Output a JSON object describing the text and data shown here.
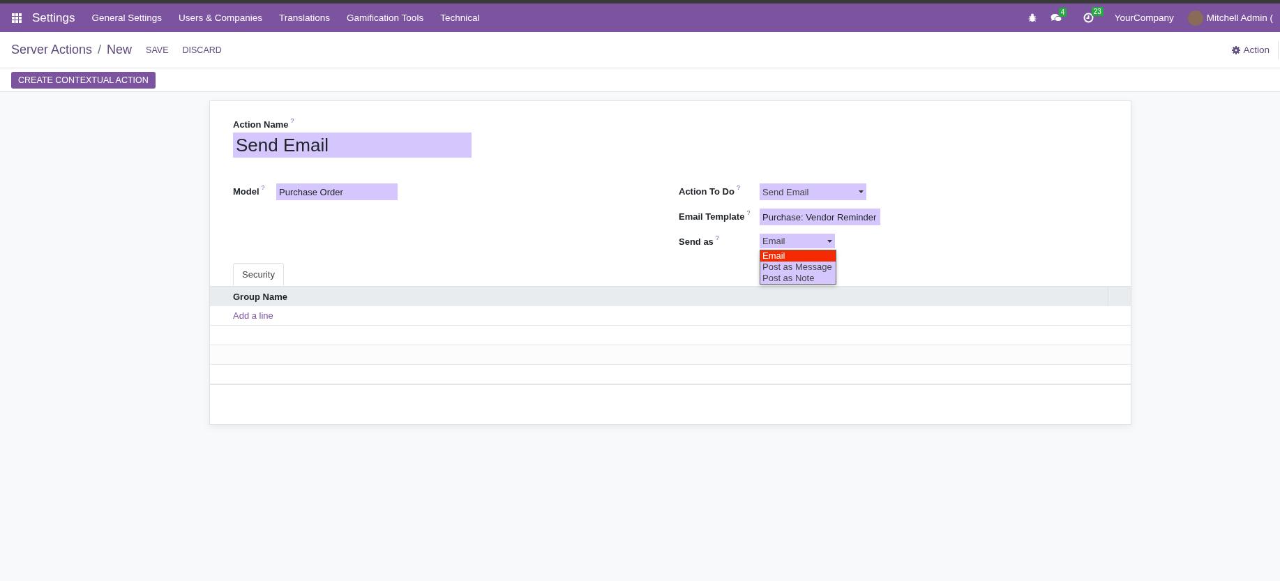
{
  "navbar": {
    "app_name": "Settings",
    "menu": [
      "General Settings",
      "Users & Companies",
      "Translations",
      "Gamification Tools",
      "Technical"
    ],
    "messages_count": "4",
    "activities_count": "23",
    "company": "YourCompany",
    "user": "Mitchell Admin ("
  },
  "breadcrumb": {
    "parent": "Server Actions",
    "separator": "/",
    "current": "New"
  },
  "header_buttons": [
    "SAVE",
    "DISCARD"
  ],
  "action_menu": "Action",
  "statusbar_button": "CREATE CONTEXTUAL ACTION",
  "form": {
    "action_name_label": "Action Name",
    "action_name_help": "?",
    "action_name": "Send Email",
    "model": {
      "label": "Model",
      "help": "?",
      "value": "Purchase Order"
    },
    "right_fields": [
      {
        "kind": "select",
        "label": "Action To Do",
        "help": "?",
        "value": "Send Email"
      },
      {
        "kind": "input",
        "label": "Email Template",
        "help": "?",
        "value": "Purchase: Vendor Reminder"
      },
      {
        "kind": "select",
        "label": "Send as",
        "help": "?",
        "value": "Email",
        "options": [
          {
            "label": "Email",
            "selected": true
          },
          {
            "label": "Post as Message",
            "selected": false
          },
          {
            "label": "Post as Note",
            "selected": false
          }
        ]
      }
    ],
    "tabs": [
      {
        "label": "Security",
        "selected": true
      }
    ],
    "table": {
      "columns": [
        "Group Name"
      ],
      "add_line": "Add a line"
    }
  }
}
